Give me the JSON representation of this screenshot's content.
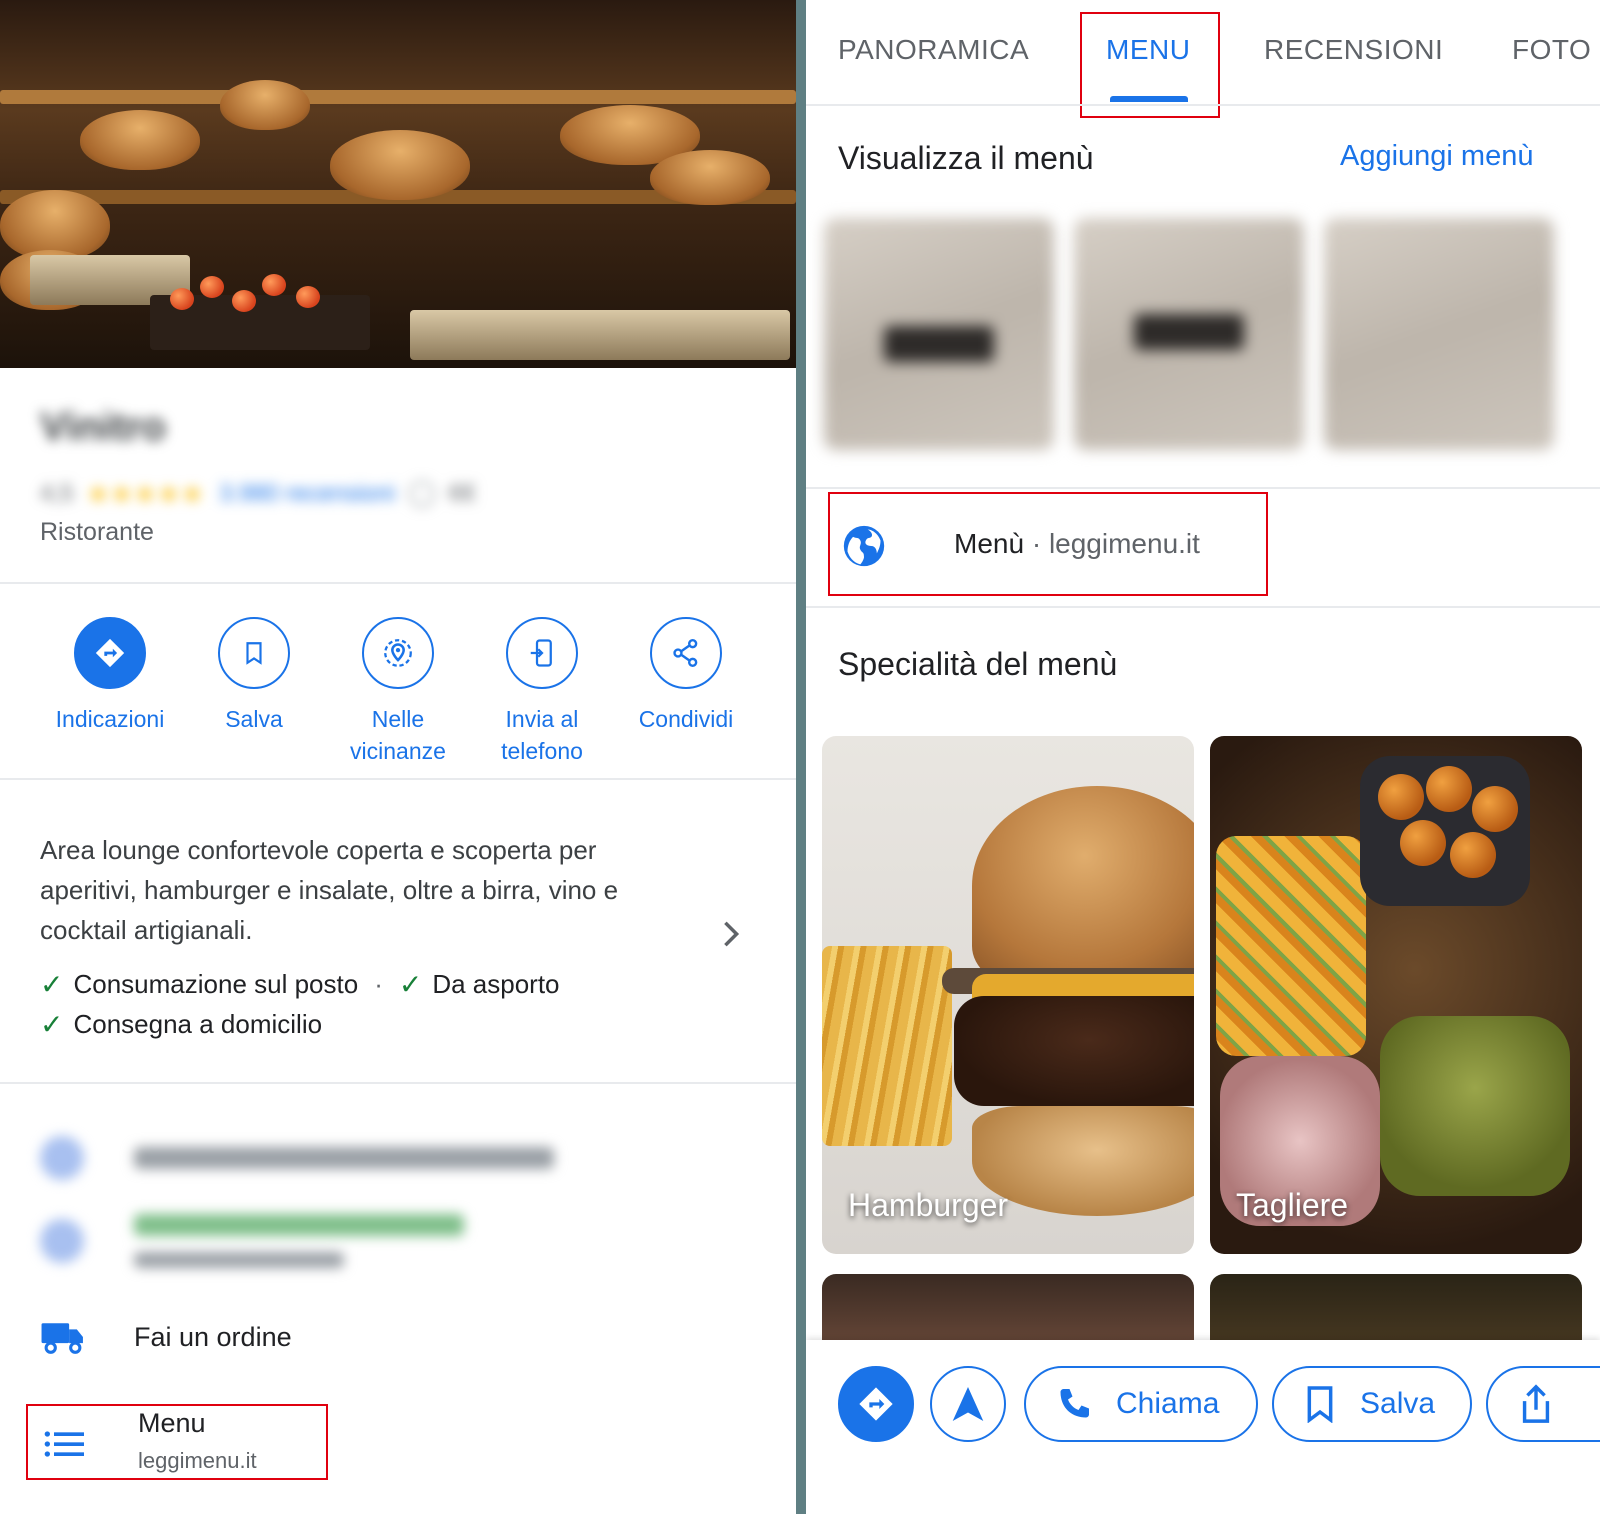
{
  "left": {
    "place_name": "Vinitro",
    "rating": "4,5",
    "stars": "★★★★★",
    "reviews": "3.980 recensioni",
    "price": "€€",
    "place_type": "Ristorante",
    "actions": [
      {
        "label": "Indicazioni"
      },
      {
        "label": "Salva"
      },
      {
        "label": "Nelle vicinanze",
        "line1": "Nelle",
        "line2": "vicinanze"
      },
      {
        "label": "Invia al telefono",
        "line1": "Invia al",
        "line2": "telefono"
      },
      {
        "label": "Condividi"
      }
    ],
    "description": "Area lounge confortevole coperta e scoperta per aperitivi, hamburger e insalate, oltre a birra, vino e cocktail artigianali.",
    "services": {
      "dine_in": "Consumazione sul posto",
      "takeaway": "Da asporto",
      "delivery": "Consegna a domicilio",
      "check": "✓",
      "separator": "·"
    },
    "order_label": "Fai un ordine",
    "menu_row": {
      "title": "Menu",
      "site": "leggimenu.it"
    }
  },
  "right": {
    "tabs": [
      {
        "label": "PANORAMICA"
      },
      {
        "label": "MENU"
      },
      {
        "label": "RECENSIONI"
      },
      {
        "label": "FOTO"
      }
    ],
    "view_menu_title": "Visualizza il menù",
    "add_menu_label": "Aggiungi menù",
    "web_row": {
      "label": "Menù",
      "separator": " · ",
      "site": "leggimenu.it"
    },
    "specialties_title": "Specialità del menù",
    "specialties": [
      {
        "caption": "Hamburger"
      },
      {
        "caption": "Tagliere"
      }
    ],
    "bottom_bar": {
      "call_label": "Chiama",
      "save_label": "Salva"
    }
  },
  "colors": {
    "accent": "#1a73e8",
    "highlight_box": "#e0000f",
    "check_green": "#188038"
  },
  "icons": [
    "directions-icon",
    "bookmark-icon",
    "nearby-icon",
    "send-to-phone-icon",
    "share-icon",
    "chevron-right-icon",
    "check-icon",
    "delivery-truck-icon",
    "menu-list-icon",
    "globe-icon",
    "navigation-arrow-icon",
    "phone-icon",
    "upload-share-icon"
  ]
}
